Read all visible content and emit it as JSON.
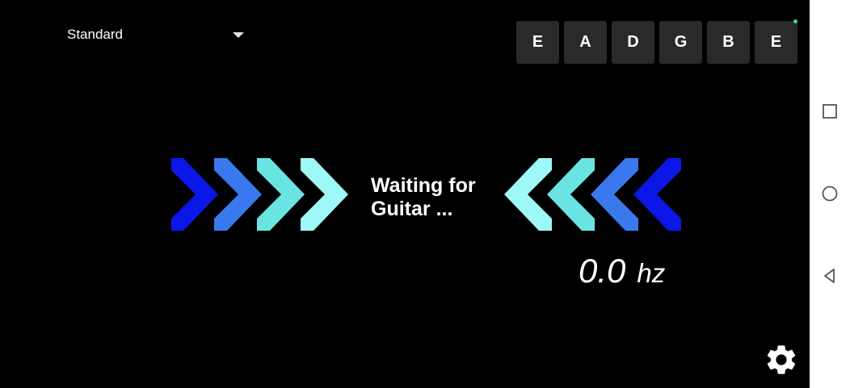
{
  "tuning": {
    "selected": "Standard"
  },
  "strings": [
    "E",
    "A",
    "D",
    "G",
    "B",
    "E"
  ],
  "status": {
    "line1": "Waiting for",
    "line2": "Guitar ..."
  },
  "frequency": {
    "value": "0.0",
    "unit": "hz"
  },
  "colors": {
    "background": "#000000",
    "chevron_dark_blue": "#0a17e6",
    "chevron_blue": "#3a78ee",
    "chevron_teal": "#6ae3e3",
    "chevron_light": "#9ff8f8",
    "button_bg": "#2a2a2a",
    "status_dot": "#3ddc84"
  },
  "icons": {
    "settings": "gear-icon",
    "recents": "square-icon",
    "home": "circle-icon",
    "back": "triangle-back-icon",
    "dropdown": "caret-down-icon"
  }
}
